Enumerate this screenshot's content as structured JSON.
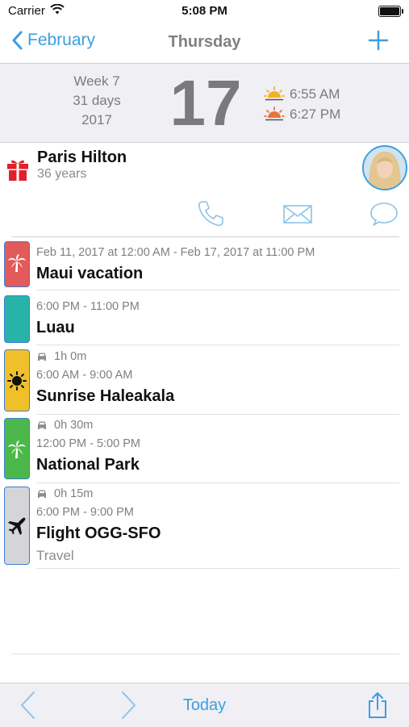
{
  "status_bar": {
    "carrier": "Carrier",
    "time": "5:08 PM"
  },
  "nav": {
    "back_label": "February",
    "title": "Thursday"
  },
  "day_header": {
    "week": "Week 7",
    "days": "31 days",
    "year": "2017",
    "day_number": "17",
    "sunrise": "6:55 AM",
    "sunset": "6:27 PM"
  },
  "person": {
    "name": "Paris Hilton",
    "age": "36 years"
  },
  "events": [
    {
      "time": "Feb 11, 2017 at 12:00 AM - Feb 17, 2017 at 11:00 PM",
      "title": "Maui vacation",
      "color": "#e35a5a",
      "icon": "palm-tree-icon"
    },
    {
      "time": "6:00 PM - 11:00 PM",
      "title": "Luau",
      "color": "#27b3a8",
      "icon": ""
    },
    {
      "drive": "1h 0m",
      "time": "6:00 AM - 9:00 AM",
      "title": "Sunrise Haleakala",
      "color": "#f0c02a",
      "icon": "sun-icon"
    },
    {
      "drive": "0h 30m",
      "time": "12:00 PM - 5:00 PM",
      "title": "National Park",
      "color": "#4cb84a",
      "icon": "palm-tree-icon"
    },
    {
      "drive": "0h 15m",
      "time": "6:00 PM - 9:00 PM",
      "title": "Flight OGG-SFO",
      "subtitle": "Travel",
      "color": "#d5d5d8",
      "icon": "airplane-icon"
    }
  ],
  "toolbar": {
    "today_label": "Today"
  }
}
